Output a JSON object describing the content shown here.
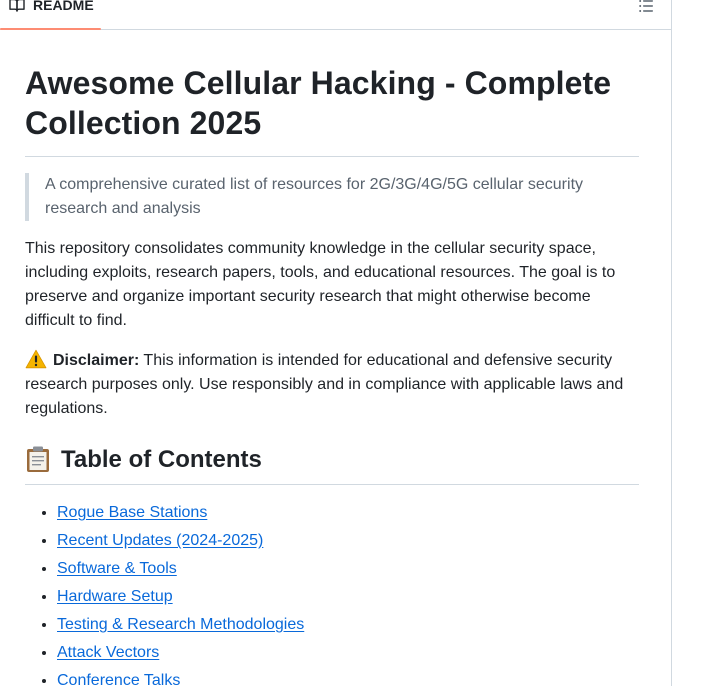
{
  "tab": {
    "label": "README",
    "icon": "book-icon"
  },
  "toc_button": {
    "icon": "list-unordered-icon"
  },
  "readme": {
    "title": "Awesome Cellular Hacking - Complete Collection 2025",
    "tagline": "A comprehensive curated list of resources for 2G/3G/4G/5G cellular security research and analysis",
    "intro": "This repository consolidates community knowledge in the cellular security space, including exploits, research papers, tools, and educational resources. The goal is to preserve and organize important security research that might otherwise become difficult to find.",
    "disclaimer_label": "Disclaimer:",
    "disclaimer_text": " This information is intended for educational and defensive security research purposes only. Use responsibly and in compliance with applicable laws and regulations.",
    "toc_heading": "Table of Contents",
    "toc_items": [
      "Rogue Base Stations",
      "Recent Updates (2024-2025)",
      "Software & Tools",
      "Hardware Setup",
      "Testing & Research Methodologies",
      "Attack Vectors",
      "Conference Talks"
    ]
  },
  "colors": {
    "accent_underline": "#fd8c73",
    "link": "#0969da",
    "border": "#d1d9e0"
  }
}
